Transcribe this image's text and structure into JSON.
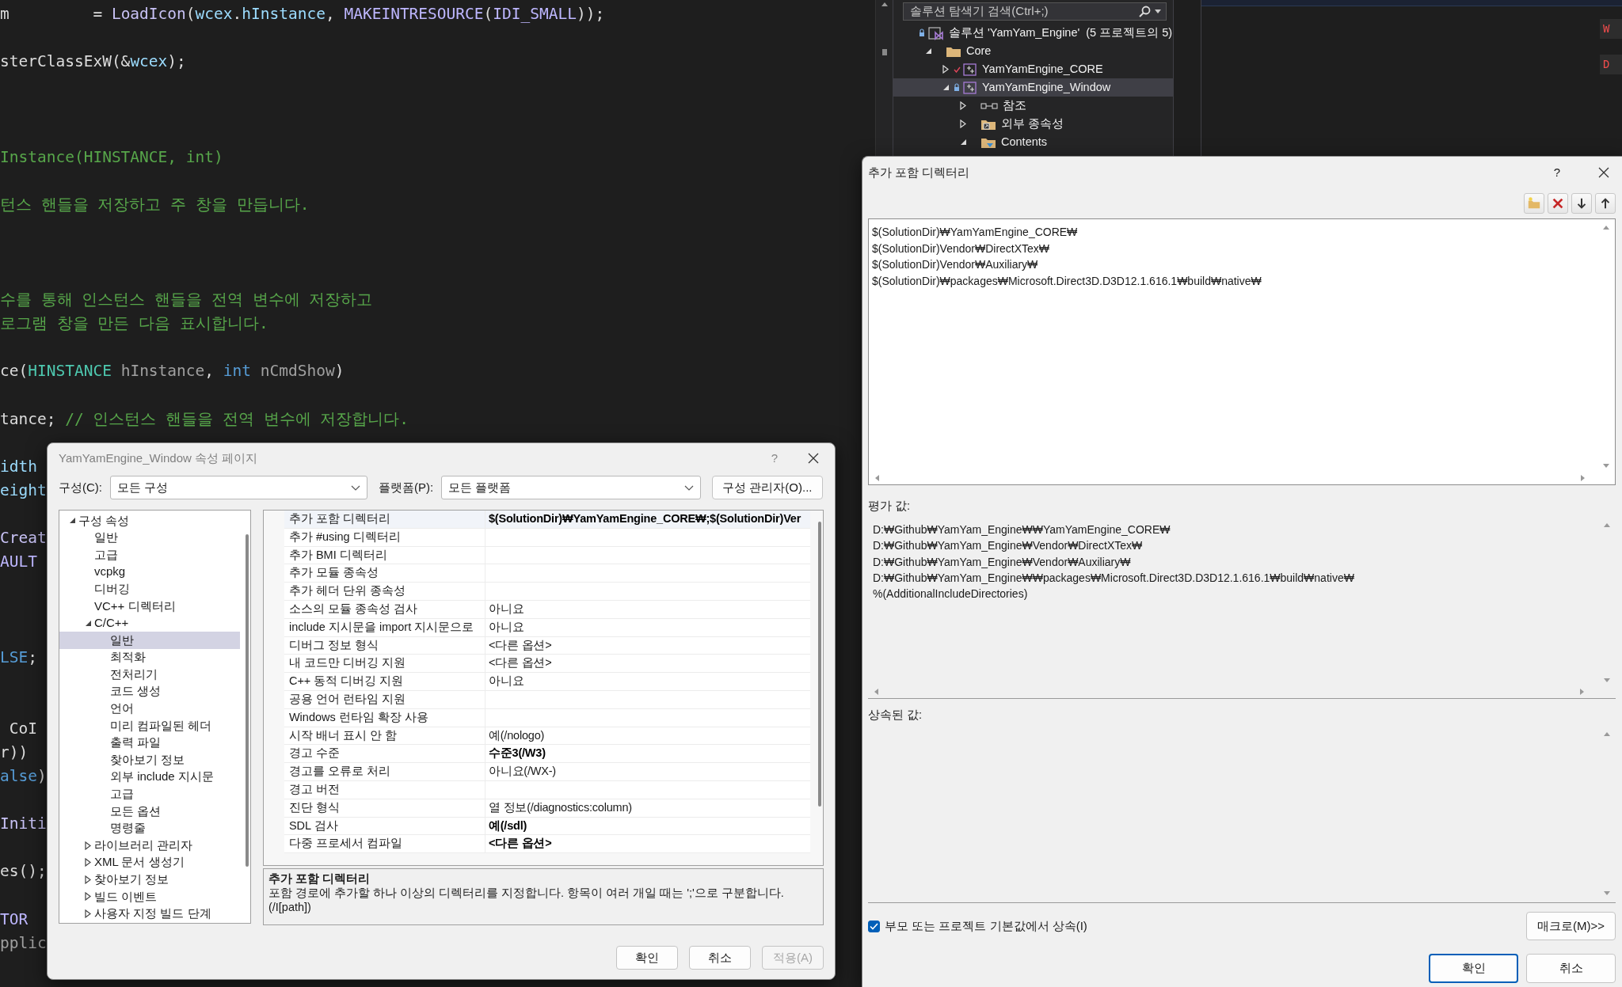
{
  "editor": {
    "code_lines": [
      {
        "tokens": [
          {
            "kind": "plain",
            "text": "m         = "
          },
          {
            "kind": "func",
            "text": "LoadIcon"
          },
          {
            "kind": "plain",
            "text": "("
          },
          {
            "kind": "var",
            "text": "wcex"
          },
          {
            "kind": "plain",
            "text": "."
          },
          {
            "kind": "var",
            "text": "hInstance"
          },
          {
            "kind": "plain",
            "text": ", "
          },
          {
            "kind": "macro",
            "text": "MAKEINTRESOURCE"
          },
          {
            "kind": "plain",
            "text": "("
          },
          {
            "kind": "macro",
            "text": "IDI_SMALL"
          },
          {
            "kind": "plain",
            "text": "));"
          }
        ]
      },
      {
        "tokens": [
          {
            "kind": "plain",
            "text": "sterClassExW(&"
          },
          {
            "kind": "var",
            "text": "wcex"
          },
          {
            "kind": "plain",
            "text": ");"
          }
        ]
      },
      {
        "tokens": [
          {
            "kind": "comment",
            "text": "Instance(HINSTANCE, int)"
          }
        ]
      },
      {
        "tokens": [
          {
            "kind": "comment",
            "text": "턴스 핸들을 저장하고 주 창을 만듭니다."
          }
        ]
      },
      {
        "tokens": [
          {
            "kind": "comment",
            "text": "수를 통해 인스턴스 핸들을 전역 변수에 저장하고"
          }
        ]
      },
      {
        "tokens": [
          {
            "kind": "comment",
            "text": "로그램 창을 만든 다음 표시합니다."
          }
        ]
      },
      {
        "tokens": [
          {
            "kind": "plain",
            "text": "ce("
          },
          {
            "kind": "type",
            "text": "HINSTANCE"
          },
          {
            "kind": "param",
            "text": " hInstance"
          },
          {
            "kind": "plain",
            "text": ", "
          },
          {
            "kind": "keyword",
            "text": "int"
          },
          {
            "kind": "param",
            "text": " nCmdShow"
          },
          {
            "kind": "plain",
            "text": ")"
          }
        ]
      },
      {
        "tokens": [
          {
            "kind": "plain",
            "text": "tance; "
          },
          {
            "kind": "comment",
            "text": "// 인스턴스 핸들을 전역 변수에 저장합니다."
          }
        ]
      },
      {
        "tokens": [
          {
            "kind": "var",
            "text": "idth"
          }
        ]
      },
      {
        "tokens": [
          {
            "kind": "var",
            "text": "eight"
          }
        ]
      },
      {
        "tokens": [
          {
            "kind": "func",
            "text": "Creat"
          }
        ]
      },
      {
        "tokens": [
          {
            "kind": "macro",
            "text": "AULT"
          }
        ]
      },
      {
        "tokens": [
          {
            "kind": "keyword",
            "text": "LSE"
          },
          {
            "kind": "plain",
            "text": ";"
          }
        ]
      },
      {
        "tokens": [
          {
            "kind": "plain",
            "text": " CoI"
          }
        ]
      },
      {
        "tokens": [
          {
            "kind": "plain",
            "text": "r))"
          }
        ]
      },
      {
        "tokens": [
          {
            "kind": "keyword",
            "text": "alse"
          },
          {
            "kind": "plain",
            "text": ")"
          }
        ]
      },
      {
        "tokens": [
          {
            "kind": "func",
            "text": "Initi"
          }
        ]
      },
      {
        "tokens": [
          {
            "kind": "plain",
            "text": "es();"
          }
        ]
      },
      {
        "tokens": [
          {
            "kind": "macro",
            "text": "TOR"
          }
        ]
      },
      {
        "tokens": [
          {
            "kind": "param",
            "text": "pplic"
          }
        ]
      }
    ]
  },
  "solution_explorer": {
    "search": {
      "placeholder": "솔루션 탐색기 검색(Ctrl+;)"
    },
    "tree": [
      {
        "kind": "solution",
        "label": "솔루션 'YamYam_Engine'",
        "note": "(5 프로젝트의 5)",
        "locked": true,
        "checked": false,
        "selected": false,
        "children": [
          {
            "kind": "folder",
            "label": "Core",
            "expanded": true,
            "selected": false,
            "children": [
              {
                "kind": "project",
                "label": "YamYamEngine_CORE",
                "locked": false,
                "checked": true,
                "expanded": false,
                "selected": false
              },
              {
                "kind": "project",
                "label": "YamYamEngine_Window",
                "locked": true,
                "checked": false,
                "expanded": true,
                "selected": true,
                "children": [
                  {
                    "kind": "references",
                    "label": "참조",
                    "expanded": false,
                    "selected": false
                  },
                  {
                    "kind": "dependencies",
                    "label": "외부 종속성",
                    "expanded": false,
                    "selected": false
                  },
                  {
                    "kind": "content_folder",
                    "label": "Contents",
                    "expanded": true,
                    "selected": false
                  }
                ]
              }
            ]
          }
        ]
      }
    ]
  },
  "error_chips": [
    "W",
    "D"
  ],
  "properties_dialog": {
    "title": "YamYamEngine_Window 속성 페이지",
    "help": "?",
    "config_label": "구성(C):",
    "config_value": "모든 구성",
    "platform_label": "플랫폼(P):",
    "platform_value": "모든 플랫폼",
    "manager_button": "구성 관리자(O)...",
    "tree": [
      {
        "label": "구성 속성",
        "expanded": true,
        "selected": false,
        "children": [
          {
            "label": "일반",
            "selected": false
          },
          {
            "label": "고급",
            "selected": false
          },
          {
            "label": "vcpkg",
            "selected": false
          },
          {
            "label": "디버깅",
            "selected": false
          },
          {
            "label": "VC++ 디렉터리",
            "selected": false
          },
          {
            "label": "C/C++",
            "expanded": true,
            "selected": false,
            "children": [
              {
                "label": "일반",
                "selected": true
              },
              {
                "label": "최적화",
                "selected": false
              },
              {
                "label": "전처리기",
                "selected": false
              },
              {
                "label": "코드 생성",
                "selected": false
              },
              {
                "label": "언어",
                "selected": false
              },
              {
                "label": "미리 컴파일된 헤더",
                "selected": false
              },
              {
                "label": "출력 파일",
                "selected": false
              },
              {
                "label": "찾아보기 정보",
                "selected": false
              },
              {
                "label": "외부 include 지시문",
                "selected": false
              },
              {
                "label": "고급",
                "selected": false
              },
              {
                "label": "모든 옵션",
                "selected": false
              },
              {
                "label": "명령줄",
                "selected": false
              }
            ]
          },
          {
            "label": "라이브러리 관리자",
            "expanded": false,
            "selected": false
          },
          {
            "label": "XML 문서 생성기",
            "expanded": false,
            "selected": false
          },
          {
            "label": "찾아보기 정보",
            "expanded": false,
            "selected": false
          },
          {
            "label": "빌드 이벤트",
            "expanded": false,
            "selected": false
          },
          {
            "label": "사용자 지정 빌드 단계",
            "expanded": false,
            "selected": false
          }
        ]
      }
    ],
    "grid_rows": [
      {
        "name": "추가 포함 디렉터리",
        "value": "$(SolutionDir)₩YamYamEngine_CORE₩;$(SolutionDir)Ver",
        "bold": true,
        "selected": true
      },
      {
        "name": "추가 #using 디렉터리",
        "selected": false
      },
      {
        "name": "추가 BMI 디렉터리",
        "selected": false
      },
      {
        "name": "추가 모듈 종속성",
        "selected": false
      },
      {
        "name": "추가 헤더 단위 종속성",
        "selected": false
      },
      {
        "name": "소스의 모듈 종속성 검사",
        "value": "아니요",
        "bold": false,
        "selected": false
      },
      {
        "name": "include 지시문을 import 지시문으로",
        "value": "아니요",
        "bold": false,
        "selected": false
      },
      {
        "name": "디버그 정보 형식",
        "value": "<다른 옵션>",
        "bold": false,
        "selected": false
      },
      {
        "name": "내 코드만 디버깅 지원",
        "value": "<다른 옵션>",
        "bold": false,
        "selected": false
      },
      {
        "name": "C++ 동적 디버깅 지원",
        "value": "아니요",
        "bold": false,
        "selected": false
      },
      {
        "name": "공용 언어 런타임 지원",
        "selected": false
      },
      {
        "name": "Windows 런타임 확장 사용",
        "selected": false
      },
      {
        "name": "시작 배너 표시 안 함",
        "value": "예(/nologo)",
        "bold": false,
        "selected": false
      },
      {
        "name": "경고 수준",
        "value": "수준3(/W3)",
        "bold": true,
        "selected": false
      },
      {
        "name": "경고를 오류로 처리",
        "value": "아니요(/WX-)",
        "bold": false,
        "selected": false
      },
      {
        "name": "경고 버전",
        "selected": false
      },
      {
        "name": "진단 형식",
        "value": "열 정보(/diagnostics:column)",
        "bold": false,
        "selected": false
      },
      {
        "name": "SDL 검사",
        "value": "예(/sdl)",
        "bold": true,
        "selected": false
      },
      {
        "name": "다중 프로세서 컴파일",
        "value": "<다른 옵션>",
        "bold": true,
        "selected": false
      }
    ],
    "description": {
      "title": "추가 포함 디렉터리",
      "text": "포함 경로에 추가할 하나 이상의 디렉터리를 지정합니다. 항목이 여러 개일 때는 ';'으로 구분합니다. (/I[path])"
    },
    "buttons": [
      {
        "label": "확인",
        "disabled": false
      },
      {
        "label": "취소",
        "disabled": false
      },
      {
        "label": "적용(A)",
        "disabled": true
      }
    ]
  },
  "include_dialog": {
    "title": "추가 포함 디렉터리",
    "help": "?",
    "entries": [
      "$(SolutionDir)₩YamYamEngine_CORE₩",
      "$(SolutionDir)Vendor₩DirectXTex₩",
      "$(SolutionDir)Vendor₩Auxiliary₩",
      "$(SolutionDir)₩packages₩Microsoft.Direct3D.D3D12.1.616.1₩build₩native₩"
    ],
    "evaluated_label": "평가 값:",
    "evaluated": [
      "D:₩Github₩YamYam_Engine₩₩YamYamEngine_CORE₩",
      "D:₩Github₩YamYam_Engine₩Vendor₩DirectXTex₩",
      "D:₩Github₩YamYam_Engine₩Vendor₩Auxiliary₩",
      "D:₩Github₩YamYam_Engine₩₩packages₩Microsoft.Direct3D.D3D12.1.616.1₩build₩native₩",
      "%(AdditionalIncludeDirectories)"
    ],
    "inherited_label": "상속된 값:",
    "inherit_checkbox": {
      "label": "부모 또는 프로젝트 기본값에서 상속(I)",
      "checked": true
    },
    "macro_button": "매크로(M)>>",
    "buttons": [
      {
        "label": "확인",
        "default": true
      },
      {
        "label": "취소",
        "default": false
      }
    ]
  }
}
